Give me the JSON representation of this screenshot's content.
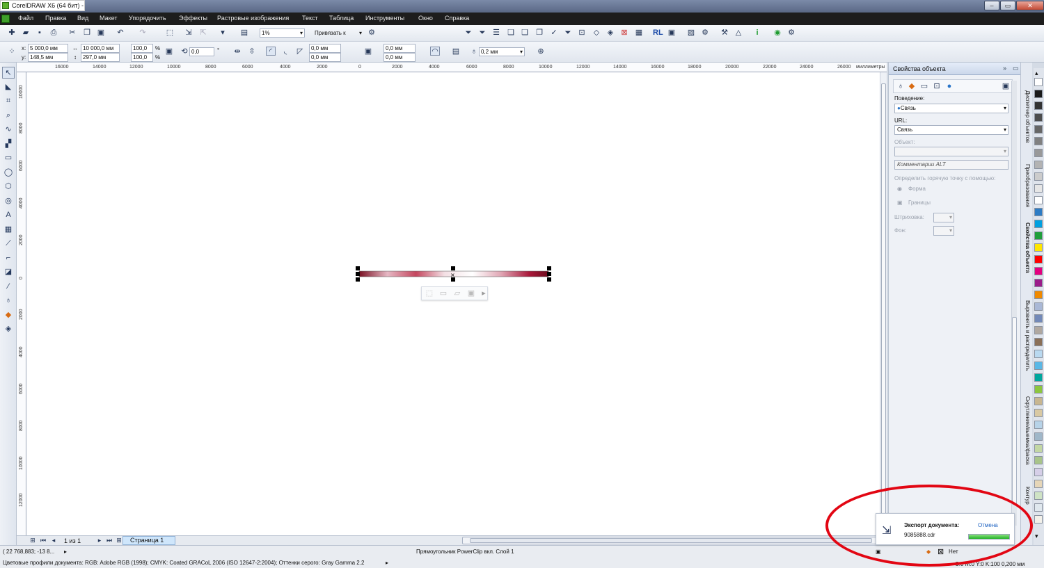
{
  "window": {
    "title": "CorelDRAW X6 (64 бит) -"
  },
  "menu": [
    "Файл",
    "Правка",
    "Вид",
    "Макет",
    "Упорядочить",
    "Эффекты",
    "Растровые изображения",
    "Текст",
    "Таблица",
    "Инструменты",
    "Окно",
    "Справка"
  ],
  "toolbar": {
    "zoom": "1%",
    "snap": "Привязать к"
  },
  "propbar": {
    "x_label": "x:",
    "x": "5 000,0 мм",
    "y_label": "y:",
    "y": "148,5 мм",
    "w": "10 000,0 мм",
    "h": "297,0 мм",
    "scale_x": "100,0",
    "scale_y": "100,0",
    "percent": "%",
    "angle": "0,0",
    "degree": "°",
    "corner1": "0,0 мм",
    "corner2": "0,0 мм",
    "corner3": "0,0 мм",
    "corner4": "0,0 мм",
    "outline": "0,2 мм"
  },
  "ruler": {
    "unit": "миллиметры",
    "h_ticks": [
      "16000",
      "14000",
      "12000",
      "10000",
      "8000",
      "6000",
      "4000",
      "2000",
      "0",
      "2000",
      "4000",
      "6000",
      "8000",
      "10000",
      "12000",
      "14000",
      "16000",
      "18000",
      "20000",
      "22000",
      "24000",
      "26000"
    ],
    "v_ticks": [
      "10000",
      "8000",
      "6000",
      "4000",
      "2000",
      "0",
      "2000",
      "4000",
      "6000",
      "8000",
      "10000",
      "12000"
    ]
  },
  "pages": {
    "counter": "1 из 1",
    "tab": "Страница 1"
  },
  "docker": {
    "title": "Свойства объекта",
    "behavior_label": "Поведение:",
    "behavior_value": "Связь",
    "url_label": "URL:",
    "url_value": "Связь",
    "object_label": "Объект:",
    "alt_comment": "Комментарии ALT",
    "hotspot_label": "Определить горячую точку с помощью:",
    "opt_shape": "Форма",
    "opt_bounds": "Границы",
    "hatch_label": "Штриховка:",
    "bg_label": "Фон:"
  },
  "vtabs": [
    "Диспетчер объектов",
    "Преобразования",
    "Свойства объекта",
    "Выровнять и распределить",
    "Скругление/выемка/фаска",
    "Контур"
  ],
  "status": {
    "coords": "( 22 768,883; -13 8...",
    "object_info": "Прямоугольник PowerClip вкл. Слой 1",
    "color_profiles": "Цветовые профили документа: RGB: Adobe RGB (1998); CMYK: Coated GRACoL 2006 (ISO 12647-2:2004); Оттенки серого: Gray Gamma 2.2",
    "fill_none": "Нет",
    "outline_info": "C:0 M:0 Y:0 K:100  0,200 мм"
  },
  "notification": {
    "title": "Экспорт документа:",
    "filename": "9085888.cdr",
    "cancel": "Отмена",
    "progress": 1.0
  },
  "colors": {
    "accent": "#e20613",
    "palette": [
      "#ffffff",
      "#1a1a1a",
      "#333333",
      "#4d4d4d",
      "#666666",
      "#808080",
      "#999999",
      "#b3b3b3",
      "#cccccc",
      "#e6e6e6",
      "#ffffff",
      "#2d7cc4",
      "#00a0e0",
      "#1f9e3a",
      "#ffe600",
      "#ff0000",
      "#e4007f",
      "#9b1d8a",
      "#f08a00",
      "#a9b8d6",
      "#7289b8",
      "#b0a8a0",
      "#8a6f57",
      "#b9d9f0",
      "#5ab8e6",
      "#00a79d",
      "#8cc63f",
      "#c8b690",
      "#d9c9a3",
      "#b7d3e8",
      "#9fb7c9",
      "#c3d7a4",
      "#a8c48a",
      "#d6cfe8",
      "#e6d6b8",
      "#cfe3c5",
      "#e0e8ee",
      "#f3f1ea"
    ]
  }
}
